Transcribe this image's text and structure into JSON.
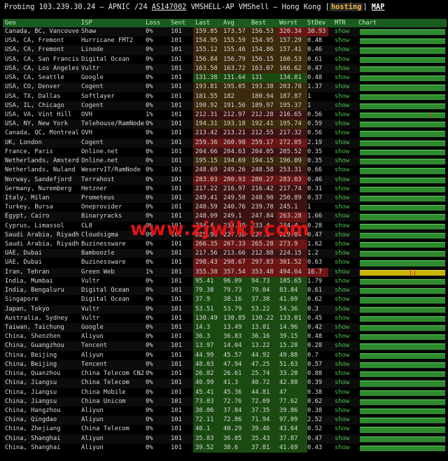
{
  "header": {
    "prefix": "Probing 103.239.30.24 – APNIC /24",
    "asn": "AS147002",
    "mid": "VMSHELL-AP VMShell – Hong Kong",
    "host_tag": "hosting",
    "map_link": "MAP"
  },
  "watermark": "www.zjwiki.com",
  "columns": {
    "geo": "Geo",
    "isp": "ISP",
    "loss": "Loss",
    "sent": "Sent",
    "last": "Last",
    "avg": "Avg",
    "best": "Best",
    "worst": "Worst",
    "stdev": "StDev",
    "mtr": "MTR",
    "chart": "Chart"
  },
  "rows": [
    {
      "geo": "Canada, BC, Vancouver",
      "isp": "Shaw",
      "loss": "0%",
      "sent": "101",
      "last": "159.85",
      "avg": "173.57",
      "best": "156.53",
      "worst": "320.34",
      "stdev": "30.93",
      "mtr": "show",
      "c": "y1,y1,y1,r2,r2"
    },
    {
      "geo": "USA, CA, Fremont",
      "isp": "Hurricane FMT2",
      "loss": "0%",
      "sent": "101",
      "last": "154.95",
      "avg": "155.59",
      "best": "154.95",
      "worst": "157.29",
      "stdev": "0.48",
      "mtr": "show",
      "c": "y1,y1,y1,y1,"
    },
    {
      "geo": "USA, CA, Fremont",
      "isp": "Linode",
      "loss": "0%",
      "sent": "101",
      "last": "155.12",
      "avg": "155.46",
      "best": "154.86",
      "worst": "157.41",
      "stdev": "0.46",
      "mtr": "show",
      "c": "y1,y1,y1,y1,"
    },
    {
      "geo": "USA, CA, San Francisco",
      "isp": "Digital Ocean",
      "loss": "0%",
      "sent": "101",
      "last": "156.84",
      "avg": "156.79",
      "best": "156.15",
      "worst": "160.53",
      "stdev": "0.61",
      "mtr": "show",
      "c": "y1,y1,y1,y1,"
    },
    {
      "geo": "USA, CA, Los Angeles",
      "isp": "Vultr",
      "loss": "0%",
      "sent": "101",
      "last": "163.58",
      "avg": "163.72",
      "best": "163.07",
      "worst": "166.62",
      "stdev": "0.47",
      "mtr": "show",
      "c": "y1,y1,y1,y1,"
    },
    {
      "geo": "USA, CA, Seattle",
      "isp": "Google",
      "loss": "0%",
      "sent": "101",
      "last": "131.38",
      "avg": "131.64",
      "best": "131",
      "worst": "134.81",
      "stdev": "0.48",
      "mtr": "show",
      "c": "g1,g1,g1,g1,"
    },
    {
      "geo": "USA, CO, Denver",
      "isp": "Cogent",
      "loss": "0%",
      "sent": "101",
      "last": "193.81",
      "avg": "195.05",
      "best": "193.38",
      "worst": "203.78",
      "stdev": "1.37",
      "mtr": "show",
      "c": "y1,y1,y1,y1,"
    },
    {
      "geo": "USA, TX, Dallas",
      "isp": "Softlayer",
      "loss": "0%",
      "sent": "101",
      "last": "181.55",
      "avg": "182",
      "best": "180.94",
      "worst": "187.87",
      "stdev": "1",
      "mtr": "show",
      "c": "y1,y1,y1,y1,"
    },
    {
      "geo": "USA, IL, Chicago",
      "isp": "Cogent",
      "loss": "0%",
      "sent": "101",
      "last": "190.92",
      "avg": "191.56",
      "best": "189.97",
      "worst": "195.37",
      "stdev": "1",
      "mtr": "show",
      "c": "y1,y1,y1,y1,"
    },
    {
      "geo": "USA, VA, Vint Hill",
      "isp": "OVH",
      "loss": "1%",
      "sent": "101",
      "last": "212.31",
      "avg": "212.97",
      "best": "212.28",
      "worst": "216.65",
      "stdev": "0.56",
      "mtr": "show",
      "c": "r1,r1,r1,r1,"
    },
    {
      "geo": "USA, NY, New York",
      "isp": "Telehouse/RamNode",
      "loss": "0%",
      "sent": "101",
      "last": "194.31",
      "avg": "193.18",
      "best": "192.41",
      "worst": "195.74",
      "stdev": "0.59",
      "mtr": "show",
      "c": "y1,y1,y1,y1,"
    },
    {
      "geo": "Canada, QC, Montreal",
      "isp": "OVH",
      "loss": "0%",
      "sent": "101",
      "last": "213.42",
      "avg": "213.21",
      "best": "212.55",
      "worst": "217.32",
      "stdev": "0.56",
      "mtr": "show",
      "c": "r1,r1,r1,r1,"
    },
    {
      "geo": "UK, London",
      "isp": "Cogent",
      "loss": "0%",
      "sent": "101",
      "last": "259.36",
      "avg": "260.98",
      "best": "259.17",
      "worst": "272.05",
      "stdev": "2.19",
      "mtr": "show",
      "c": "r2,r2,r2,r2,"
    },
    {
      "geo": "France, Paris",
      "isp": "Online.net",
      "loss": "0%",
      "sent": "101",
      "last": "204.66",
      "avg": "204.63",
      "best": "204.05",
      "worst": "205.52",
      "stdev": "0.35",
      "mtr": "show",
      "c": "r1,r1,r1,r1,"
    },
    {
      "geo": "Netherlands, Amsterdam",
      "isp": "Online.net",
      "loss": "0%",
      "sent": "101",
      "last": "195.15",
      "avg": "194.69",
      "best": "194.15",
      "worst": "196.09",
      "stdev": "0.35",
      "mtr": "show",
      "c": "y1,y1,y1,y1,"
    },
    {
      "geo": "Netherlands, Nuland",
      "isp": "WeservIT/RamNode",
      "loss": "0%",
      "sent": "101",
      "last": "248.69",
      "avg": "249.26",
      "best": "248.58",
      "worst": "253.31",
      "stdev": "0.66",
      "mtr": "show",
      "c": "r1,r1,r1,r1,"
    },
    {
      "geo": "Norway, Sandefjord",
      "isp": "Terrahost",
      "loss": "0%",
      "sent": "101",
      "last": "283.03",
      "avg": "280.93",
      "best": "280.27",
      "worst": "283.03",
      "stdev": "0.46",
      "mtr": "show",
      "c": "r2,r2,r2,r2,"
    },
    {
      "geo": "Germany, Nuremberg",
      "isp": "Hetzner",
      "loss": "0%",
      "sent": "101",
      "last": "217.22",
      "avg": "216.97",
      "best": "216.42",
      "worst": "217.74",
      "stdev": "0.31",
      "mtr": "show",
      "c": "r1,r1,r1,r1,"
    },
    {
      "geo": "Italy, Milan",
      "isp": "Prometeus",
      "loss": "0%",
      "sent": "101",
      "last": "249.41",
      "avg": "249.58",
      "best": "248.98",
      "worst": "250.89",
      "stdev": "0.37",
      "mtr": "show",
      "c": "r1,r1,r1,r1,"
    },
    {
      "geo": "Turkey, Bursa",
      "isp": "Oneprovider",
      "loss": "0%",
      "sent": "101",
      "last": "240.59",
      "avg": "240.76",
      "best": "239.78",
      "worst": "245.1",
      "stdev": "1",
      "mtr": "show",
      "c": "r1,r1,r1,r1,"
    },
    {
      "geo": "Egypt, Cairo",
      "isp": "Binaryracks",
      "loss": "0%",
      "sent": "101",
      "last": "248.09",
      "avg": "249.1",
      "best": "247.84",
      "worst": "263.28",
      "stdev": "1.66",
      "mtr": "show",
      "c": "r1,r1,r1,r2,"
    },
    {
      "geo": "Cyprus, Limassol",
      "isp": "CL8",
      "loss": "0%",
      "sent": "101",
      "last": "234.4",
      "avg": "233.49",
      "best": "233.4",
      "worst": "234.4",
      "stdev": "0.28",
      "mtr": "show",
      "c": "r1,r1,r1,r1,"
    },
    {
      "geo": "Saudi Arabia, Riyadh",
      "isp": "Cloudsigma",
      "loss": "0%",
      "sent": "101",
      "last": "225.96",
      "avg": "227.38",
      "best": "227.8",
      "worst": "229.84",
      "stdev": "0.47",
      "mtr": "show",
      "c": "r1,r1,r1,r1,"
    },
    {
      "geo": "Saudi Arabia, Riyadh",
      "isp": "Buzinessware",
      "loss": "0%",
      "sent": "101",
      "last": "266.35",
      "avg": "267.33",
      "best": "265.28",
      "worst": "273.9",
      "stdev": "1.62",
      "mtr": "show",
      "c": "r2,r2,r2,r2,"
    },
    {
      "geo": "UAE, Dubai",
      "isp": "Bamboozle",
      "loss": "0%",
      "sent": "101",
      "last": "217.56",
      "avg": "213.66",
      "best": "212.88",
      "worst": "224.15",
      "stdev": "1.2",
      "mtr": "show",
      "c": "r1,r1,r1,r1,"
    },
    {
      "geo": "UAE, Dubai",
      "isp": "Buzinessware",
      "loss": "0%",
      "sent": "101",
      "last": "298.43",
      "avg": "298.67",
      "best": "297.83",
      "worst": "301.52",
      "stdev": "0.63",
      "mtr": "show",
      "c": "r2,r2,r2,r2,"
    },
    {
      "geo": "Iran, Tehran",
      "isp": "Green Web",
      "loss": "1%",
      "sent": "101",
      "last": "355.38",
      "avg": "357.54",
      "best": "353.48",
      "worst": "494.04",
      "stdev": "16.7",
      "mtr": "show",
      "c": "r2,r2,r2,r2,r2",
      "chart": "y"
    },
    {
      "geo": "India, Mumbai",
      "isp": "Vultr",
      "loss": "0%",
      "sent": "101",
      "last": "95.41",
      "avg": "96.09",
      "best": "94.73",
      "worst": "105.65",
      "stdev": "1.79",
      "mtr": "show",
      "c": "g1,g1,g1,g1,"
    },
    {
      "geo": "India, Bengaluru",
      "isp": "Digital Ocean",
      "loss": "0%",
      "sent": "101",
      "last": "79.38",
      "avg": "79.73",
      "best": "79.04",
      "worst": "83.84",
      "stdev": "0.61",
      "mtr": "show",
      "c": "g1,g1,g1,g1,"
    },
    {
      "geo": "Singapore",
      "isp": "Digital Ocean",
      "loss": "0%",
      "sent": "101",
      "last": "37.9",
      "avg": "38.16",
      "best": "37.38",
      "worst": "41.69",
      "stdev": "0.62",
      "mtr": "show",
      "c": "g1,g1,g1,g1,"
    },
    {
      "geo": "Japan, Tokyo",
      "isp": "Vultr",
      "loss": "0%",
      "sent": "101",
      "last": "53.51",
      "avg": "53.79",
      "best": "53.22",
      "worst": "54.36",
      "stdev": "0.3",
      "mtr": "show",
      "c": "g1,g1,g1,g1,"
    },
    {
      "geo": "Australia, Sydney",
      "isp": "Vultr",
      "loss": "0%",
      "sent": "101",
      "last": "130.49",
      "avg": "130.85",
      "best": "130.22",
      "worst": "133.01",
      "stdev": "0.45",
      "mtr": "show",
      "c": "g1,g1,g1,g1,"
    },
    {
      "geo": "Taiwan, Taichung",
      "isp": "Google",
      "loss": "0%",
      "sent": "101",
      "last": "14.3",
      "avg": "13.49",
      "best": "13.01",
      "worst": "14.96",
      "stdev": "0.42",
      "mtr": "show",
      "c": "g1,g1,g1,g1,"
    },
    {
      "geo": "China, Shenzhen",
      "isp": "Aliyun",
      "loss": "0%",
      "sent": "101",
      "last": "36.3",
      "avg": "36.83",
      "best": "36.16",
      "worst": "39.15",
      "stdev": "0.48",
      "mtr": "show",
      "c": "g1,g1,g1,g1,"
    },
    {
      "geo": "China, Guangzhou",
      "isp": "Tencent",
      "loss": "0%",
      "sent": "101",
      "last": "13.97",
      "avg": "14.04",
      "best": "13.22",
      "worst": "15.28",
      "stdev": "0.28",
      "mtr": "show",
      "c": "g1,g1,g1,g1,"
    },
    {
      "geo": "China, Beijing",
      "isp": "Aliyun",
      "loss": "0%",
      "sent": "101",
      "last": "44.99",
      "avg": "45.57",
      "best": "44.92",
      "worst": "49.88",
      "stdev": "0.7",
      "mtr": "show",
      "c": "g1,g1,g1,g1,"
    },
    {
      "geo": "China, Beijing",
      "isp": "Tencent",
      "loss": "0%",
      "sent": "101",
      "last": "48.03",
      "avg": "47.94",
      "best": "47.25",
      "worst": "51.63",
      "stdev": "0.57",
      "mtr": "show",
      "c": "g1,g1,g1,g1,"
    },
    {
      "geo": "China, Quanzhou",
      "isp": "China Telecom CN2",
      "loss": "0%",
      "sent": "101",
      "last": "26.02",
      "avg": "26.61",
      "best": "25.74",
      "worst": "33.28",
      "stdev": "0.88",
      "mtr": "show",
      "c": "g1,g1,g1,g1,"
    },
    {
      "geo": "China, Jiangsu",
      "isp": "China Telecom",
      "loss": "0%",
      "sent": "101",
      "last": "40.99",
      "avg": "41.3",
      "best": "40.72",
      "worst": "42.88",
      "stdev": "0.39",
      "mtr": "show",
      "c": "g1,g1,g1,g1,"
    },
    {
      "geo": "China, Jiangsu",
      "isp": "China Mobile",
      "loss": "0%",
      "sent": "101",
      "last": "45.41",
      "avg": "45.36",
      "best": "44.81",
      "worst": "47",
      "stdev": "0.38",
      "mtr": "show",
      "c": "g1,g1,g1,g1,"
    },
    {
      "geo": "China, Jiangsu",
      "isp": "China Unicom",
      "loss": "0%",
      "sent": "101",
      "last": "73.03",
      "avg": "72.76",
      "best": "72.09",
      "worst": "77.62",
      "stdev": "0.62",
      "mtr": "show",
      "c": "g1,g1,g1,g1,"
    },
    {
      "geo": "China, Hangzhou",
      "isp": "Aliyun",
      "loss": "0%",
      "sent": "101",
      "last": "38.06",
      "avg": "37.84",
      "best": "37.35",
      "worst": "39.86",
      "stdev": "0.38",
      "mtr": "show",
      "c": "g1,g1,g1,g1,"
    },
    {
      "geo": "China, Qingdao",
      "isp": "Aliyun",
      "loss": "0%",
      "sent": "101",
      "last": "72.11",
      "avg": "72.86",
      "best": "71.94",
      "worst": "97.09",
      "stdev": "2.52",
      "mtr": "show",
      "c": "g1,g1,g1,g1,"
    },
    {
      "geo": "China, Zhejiang",
      "isp": "China Telecom",
      "loss": "0%",
      "sent": "101",
      "last": "40.1",
      "avg": "40.29",
      "best": "39.46",
      "worst": "43.64",
      "stdev": "0.52",
      "mtr": "show",
      "c": "g1,g1,g1,g1,"
    },
    {
      "geo": "China, Shanghai",
      "isp": "Aliyun",
      "loss": "0%",
      "sent": "101",
      "last": "35.83",
      "avg": "36.05",
      "best": "35.43",
      "worst": "37.87",
      "stdev": "0.47",
      "mtr": "show",
      "c": "g1,g1,g1,g1,"
    },
    {
      "geo": "China, Shanghai",
      "isp": "Aliyun",
      "loss": "0%",
      "sent": "101",
      "last": "39.52",
      "avg": "38.6",
      "best": "37.81",
      "worst": "41.69",
      "stdev": "0.43",
      "mtr": "show",
      "c": "g1,g1,g1,g1,"
    }
  ],
  "colors": {
    "green_bar": "#2f8a2f",
    "yellow_bar": "#c8b400",
    "latency_green": "#1a4a10",
    "latency_brown": "#3b2a0c",
    "latency_red": "#3e1212",
    "latency_hot": "#6b1515",
    "header_green": "#195c1e",
    "link": "#47c447"
  }
}
